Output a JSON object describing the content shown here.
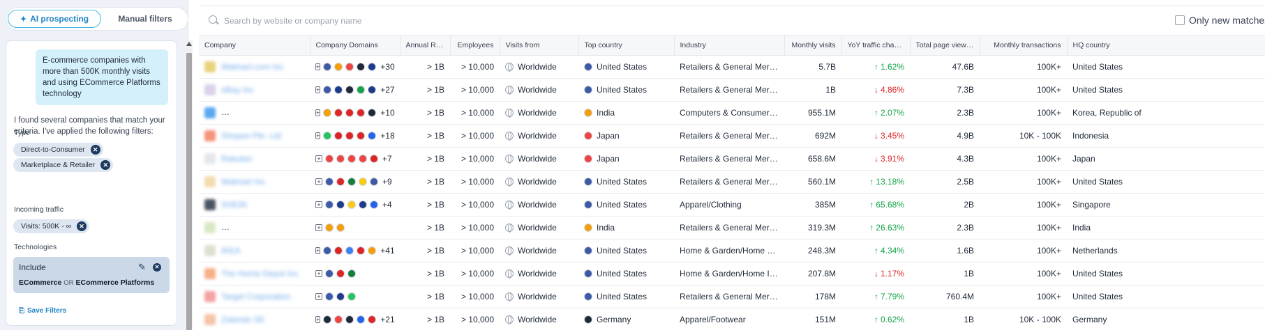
{
  "left": {
    "tabs": {
      "ai": "AI prospecting",
      "manual": "Manual filters"
    },
    "user_prompt": "E-commerce companies with more than 500K monthly visits and using ECommerce Platforms technology",
    "assistant_reply": "I found several companies that match your criteria. I've applied the following filters:",
    "type_label": "Type",
    "type_chips": [
      "Direct-to-Consumer",
      "Marketplace & Retailer"
    ],
    "traffic_label": "Incoming traffic",
    "traffic_chip": "Visits: 500K - ∞",
    "tech_label": "Technologies",
    "tech_include": "Include",
    "tech_left": "ECommerce",
    "tech_or": "OR",
    "tech_right": "ECommerce Platforms",
    "save_label": "Save Filters"
  },
  "search": {
    "placeholder": "Search by website or company name"
  },
  "only_new": "Only new matches",
  "columns": [
    "Company",
    "Company Domains",
    "Annual Reve...",
    "Employees",
    "Visits from",
    "Top country",
    "Industry",
    "Monthly visits",
    "YoY traffic chang...",
    "Total page views...",
    "Monthly transactions",
    "HQ country"
  ],
  "flags": {
    "us": "#3c5aa6",
    "in": "#f59e0b",
    "jp": "#ef4444",
    "de": "#1f2937",
    "gb": "#1e3a8a",
    "it": "#16a34a",
    "au": "#1e3a8a",
    "tr": "#dc2626",
    "cn": "#dc2626",
    "nl": "#dc2626",
    "br": "#22c55e",
    "vn": "#dc2626",
    "id": "#dc2626",
    "ph": "#2563eb",
    "ca": "#dc2626",
    "mx": "#15803d",
    "co": "#facc15",
    "se": "#2563eb",
    "gr": "#3b82f6",
    "tw": "#dc2626",
    "es": "#f59e0b",
    "pl": "#ef4444",
    "fr": "#2563eb"
  },
  "rows": [
    {
      "company": "Walmart.com Inc",
      "logo": "#e7d37a",
      "domains": [
        "us",
        "in",
        "jp",
        "de",
        "gb"
      ],
      "more": "+30",
      "revenue": "> 1B",
      "employees": "> 10,000",
      "visits_from": "Worldwide",
      "top_flag": "us",
      "top_country": "United States",
      "industry": "Retailers & General Merch...",
      "monthly_visits": "5.7B",
      "yoy_dir": "up",
      "yoy": "1.62%",
      "page_views": "47.6B",
      "transactions": "100K+",
      "hq": "United States"
    },
    {
      "company": "eBay Inc",
      "logo": "#d9d2ea",
      "domains": [
        "us",
        "gb",
        "de",
        "it",
        "au"
      ],
      "more": "+27",
      "revenue": "> 1B",
      "employees": "> 10,000",
      "visits_from": "Worldwide",
      "top_flag": "us",
      "top_country": "United States",
      "industry": "Retailers & General Merch...",
      "monthly_visits": "1B",
      "yoy_dir": "down",
      "yoy": "4.86%",
      "page_views": "7.3B",
      "transactions": "100K+",
      "hq": "United States"
    },
    {
      "company": "Samsung Electronics Co Ltd",
      "logo": "#5aa8f0",
      "domains": [
        "in",
        "tr",
        "cn",
        "nl",
        "de"
      ],
      "more": "+10",
      "revenue": "> 1B",
      "employees": "> 10,000",
      "visits_from": "Worldwide",
      "top_flag": "in",
      "top_country": "India",
      "industry": "Computers & Consumer El...",
      "monthly_visits": "955.1M",
      "yoy_dir": "up",
      "yoy": "2.07%",
      "page_views": "2.3B",
      "transactions": "100K+",
      "hq": "Korea, Republic of"
    },
    {
      "company": "Shopee Pte. Ltd",
      "logo": "#f4947a",
      "domains": [
        "br",
        "vn",
        "cn",
        "id",
        "ph"
      ],
      "more": "+18",
      "revenue": "> 1B",
      "employees": "> 10,000",
      "visits_from": "Worldwide",
      "top_flag": "jp",
      "top_country": "Japan",
      "industry": "Retailers & General Merch...",
      "monthly_visits": "692M",
      "yoy_dir": "down",
      "yoy": "3.45%",
      "page_views": "4.9B",
      "transactions": "10K - 100K",
      "hq": "Indonesia"
    },
    {
      "company": "Rakuten",
      "logo": "#e5e7eb",
      "domains": [
        "jp",
        "jp",
        "jp",
        "jp",
        "tw"
      ],
      "more": "+7",
      "revenue": "> 1B",
      "employees": "> 10,000",
      "visits_from": "Worldwide",
      "top_flag": "jp",
      "top_country": "Japan",
      "industry": "Retailers & General Merch...",
      "monthly_visits": "658.6M",
      "yoy_dir": "down",
      "yoy": "3.91%",
      "page_views": "4.3B",
      "transactions": "100K+",
      "hq": "Japan"
    },
    {
      "company": "Walmart Inc",
      "logo": "#f3dcb0",
      "domains": [
        "us",
        "ca",
        "mx",
        "co",
        "us"
      ],
      "more": "+9",
      "revenue": "> 1B",
      "employees": "> 10,000",
      "visits_from": "Worldwide",
      "top_flag": "us",
      "top_country": "United States",
      "industry": "Retailers & General Merch...",
      "monthly_visits": "560.1M",
      "yoy_dir": "up",
      "yoy": "13.18%",
      "page_views": "2.5B",
      "transactions": "100K+",
      "hq": "United States"
    },
    {
      "company": "SHEIN",
      "logo": "#4b5563",
      "domains": [
        "us",
        "gb",
        "co",
        "au",
        "se"
      ],
      "more": "+4",
      "revenue": "> 1B",
      "employees": "> 10,000",
      "visits_from": "Worldwide",
      "top_flag": "us",
      "top_country": "United States",
      "industry": "Apparel/Clothing",
      "monthly_visits": "385M",
      "yoy_dir": "up",
      "yoy": "65.68%",
      "page_views": "2B",
      "transactions": "100K+",
      "hq": "Singapore"
    },
    {
      "company": "Reliance Retail Limited",
      "logo": "#d9e8c4",
      "domains": [
        "in",
        "in"
      ],
      "more": "",
      "revenue": "> 1B",
      "employees": "> 10,000",
      "visits_from": "Worldwide",
      "top_flag": "in",
      "top_country": "India",
      "industry": "Retailers & General Merch...",
      "monthly_visits": "319.3M",
      "yoy_dir": "up",
      "yoy": "26.63%",
      "page_views": "2.3B",
      "transactions": "100K+",
      "hq": "India"
    },
    {
      "company": "IKEA",
      "logo": "#dde1cf",
      "domains": [
        "us",
        "tr",
        "gr",
        "tw",
        "es"
      ],
      "more": "+41",
      "revenue": "> 1B",
      "employees": "> 10,000",
      "visits_from": "Worldwide",
      "top_flag": "us",
      "top_country": "United States",
      "industry": "Home & Garden/Home Fur...",
      "monthly_visits": "248.3M",
      "yoy_dir": "up",
      "yoy": "4.34%",
      "page_views": "1.6B",
      "transactions": "100K+",
      "hq": "Netherlands"
    },
    {
      "company": "The Home Depot Inc",
      "logo": "#f6b08a",
      "domains": [
        "us",
        "ca",
        "mx"
      ],
      "more": "",
      "revenue": "> 1B",
      "employees": "> 10,000",
      "visits_from": "Worldwide",
      "top_flag": "us",
      "top_country": "United States",
      "industry": "Home & Garden/Home Im...",
      "monthly_visits": "207.8M",
      "yoy_dir": "down",
      "yoy": "1.17%",
      "page_views": "1B",
      "transactions": "100K+",
      "hq": "United States"
    },
    {
      "company": "Target Corporation",
      "logo": "#f4a3a3",
      "domains": [
        "us",
        "au",
        "br"
      ],
      "more": "",
      "revenue": "> 1B",
      "employees": "> 10,000",
      "visits_from": "Worldwide",
      "top_flag": "us",
      "top_country": "United States",
      "industry": "Retailers & General Merch...",
      "monthly_visits": "178M",
      "yoy_dir": "up",
      "yoy": "7.79%",
      "page_views": "760.4M",
      "transactions": "100K+",
      "hq": "United States"
    },
    {
      "company": "Zalando SE",
      "logo": "#f6c4a8",
      "domains": [
        "de",
        "pl",
        "de",
        "fr",
        "nl"
      ],
      "more": "+21",
      "revenue": "> 1B",
      "employees": "> 10,000",
      "visits_from": "Worldwide",
      "top_flag": "de",
      "top_country": "Germany",
      "industry": "Apparel/Footwear",
      "monthly_visits": "151M",
      "yoy_dir": "up",
      "yoy": "0.62%",
      "page_views": "1B",
      "transactions": "10K - 100K",
      "hq": "Germany"
    }
  ]
}
